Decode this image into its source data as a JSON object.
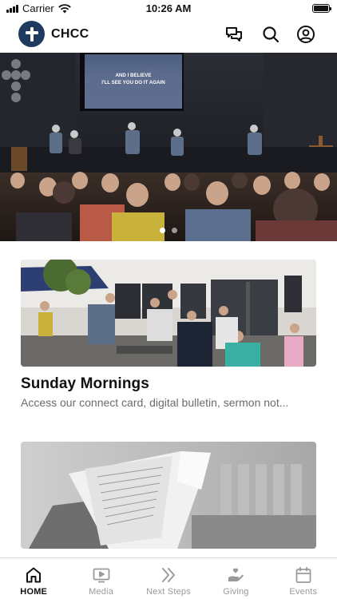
{
  "status_bar": {
    "carrier": "Carrier",
    "time": "10:26 AM"
  },
  "header": {
    "title": "CHCC",
    "logo_icon": "cross-icon",
    "actions": [
      "chat-icon",
      "search-icon",
      "profile-icon"
    ]
  },
  "hero": {
    "slide_lines": [
      "AND I BELIEVE",
      "I'LL SEE YOU DO IT AGAIN"
    ],
    "dots": {
      "count": 2,
      "active_index": 0
    }
  },
  "cards": [
    {
      "title": "Sunday Mornings",
      "subtitle": "Access our connect card, digital bulletin, sermon not..."
    },
    {
      "title": "",
      "subtitle": ""
    }
  ],
  "tabs": [
    {
      "label": "HOME",
      "icon": "home-icon",
      "active": true
    },
    {
      "label": "Media",
      "icon": "media-icon",
      "active": false
    },
    {
      "label": "Next Steps",
      "icon": "next-steps-icon",
      "active": false
    },
    {
      "label": "Giving",
      "icon": "giving-icon",
      "active": false
    },
    {
      "label": "Events",
      "icon": "events-icon",
      "active": false
    }
  ],
  "colors": {
    "brand": "#1f3a5f",
    "active_tab": "#111111",
    "inactive_tab": "#9a9a9a"
  }
}
